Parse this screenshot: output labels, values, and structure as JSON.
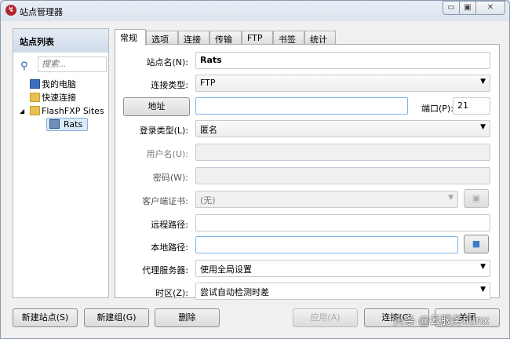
{
  "window": {
    "title": "站点管理器",
    "logo": "↯",
    "min": "▭",
    "max": "▣",
    "close": "✕"
  },
  "sidebar": {
    "header": "站点列表",
    "search_placeholder": "搜索...",
    "items": [
      {
        "label": "我的电脑",
        "icon": "computer-icon"
      },
      {
        "label": "快速连接",
        "icon": "folder-icon"
      },
      {
        "label": "FlashFXP Sites",
        "icon": "folder-icon",
        "expanded": true
      },
      {
        "label": "Rats",
        "icon": "monitor-icon",
        "selected": true
      }
    ]
  },
  "tabs": [
    "常规",
    "选项",
    "连接",
    "传输",
    "FTP",
    "书签",
    "统计"
  ],
  "form": {
    "site_name_label": "站点名(N):",
    "site_name": "Rats",
    "conn_type_label": "连接类型:",
    "conn_type": "FTP",
    "address_button": "地址",
    "address": "",
    "port_label": "端口(P):",
    "port": "21",
    "login_type_label": "登录类型(L):",
    "login_type": "匿名",
    "username_label": "用户名(U):",
    "password_label": "密码(W):",
    "cert_label": "客户端证书:",
    "cert": "(无)",
    "remote_label": "远程路径:",
    "local_label": "本地路径:",
    "proxy_label": "代理服务器:",
    "proxy": "使用全局设置",
    "tz_label": "时区(Z):",
    "tz": "尝试自动检测时差"
  },
  "buttons": {
    "new_site": "新建站点(S)",
    "new_group": "新建组(G)",
    "delete": "删除",
    "apply": "应用(A)",
    "connect": "连接(C)",
    "close": "关闭"
  },
  "watermark": "头条 @云服务liunx"
}
